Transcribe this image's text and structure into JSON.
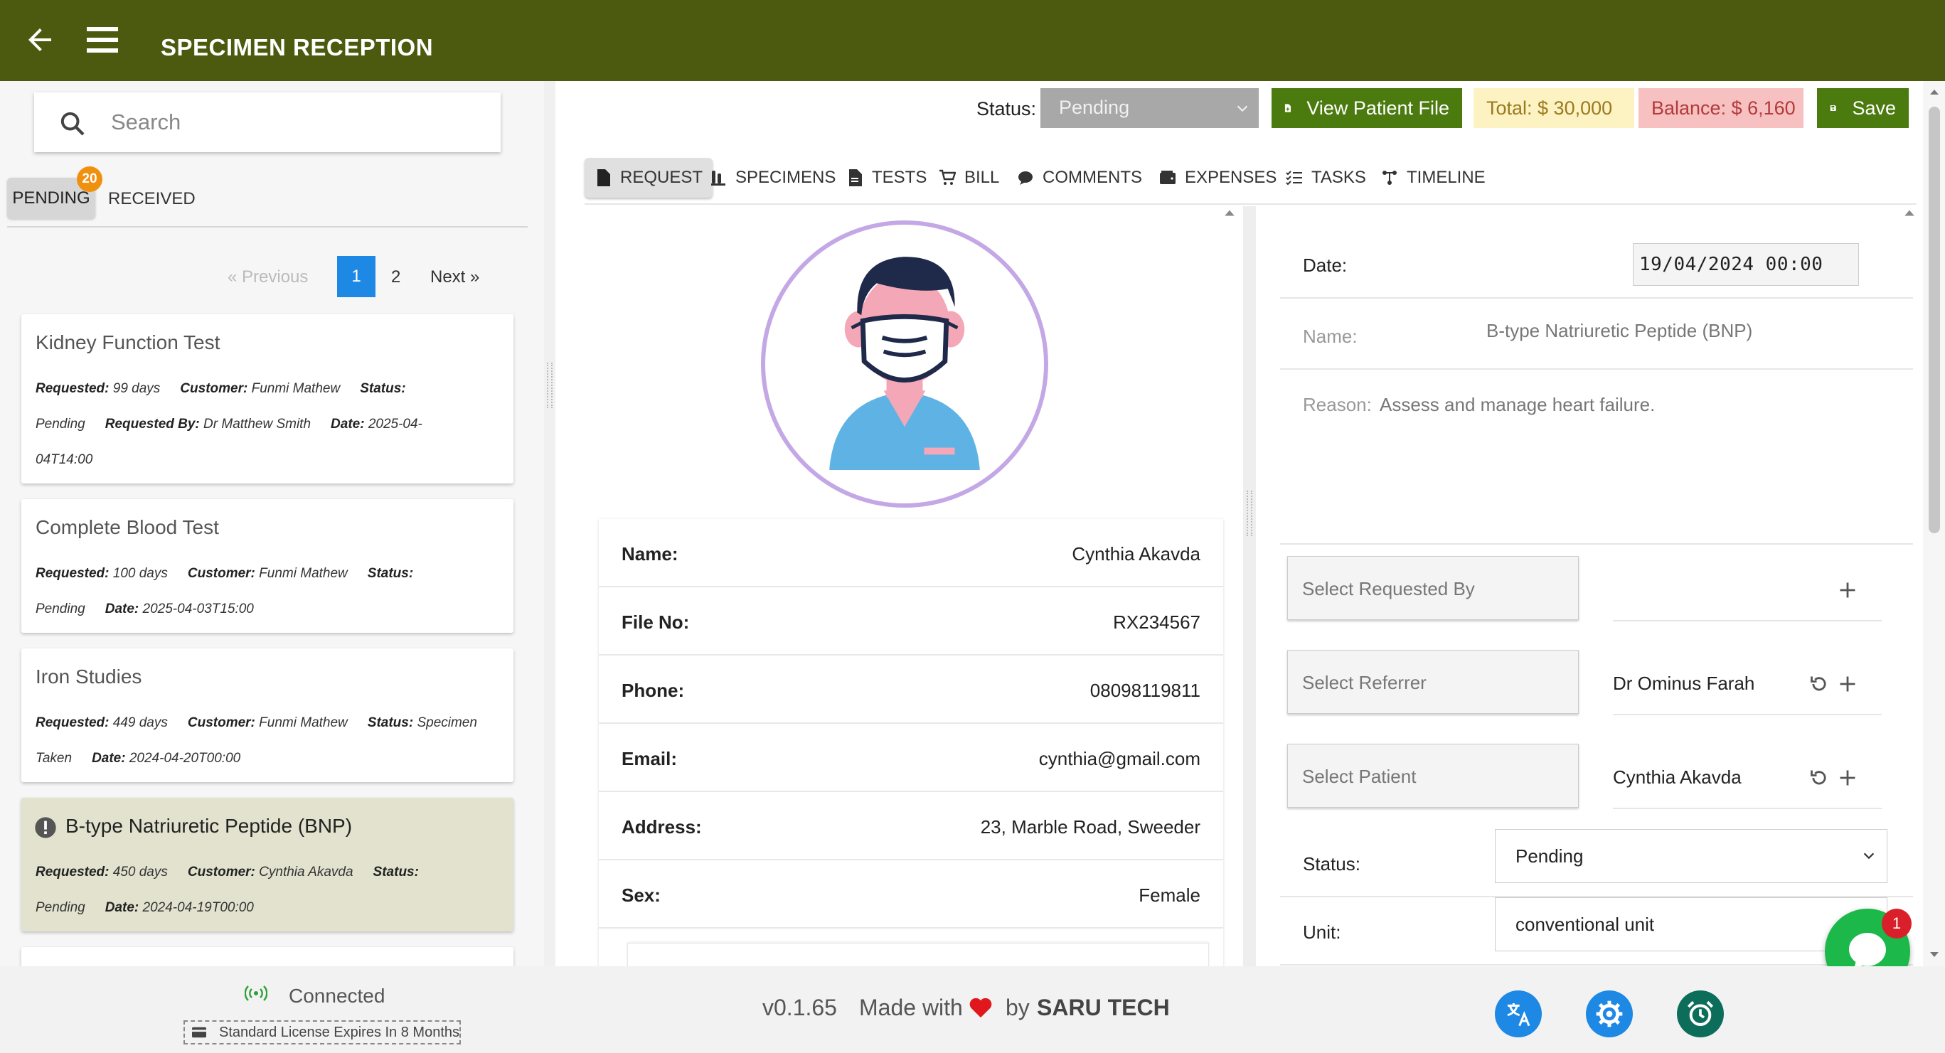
{
  "header": {
    "title": "SPECIMEN RECEPTION"
  },
  "search": {
    "placeholder": "Search"
  },
  "list_tabs": {
    "pending": "PENDING",
    "pending_count": "20",
    "received": "RECEIVED"
  },
  "pagination": {
    "previous": "« Previous",
    "page1": "1",
    "page2": "2",
    "next": "Next »"
  },
  "cards": [
    {
      "title": "Kidney Function Test",
      "lines": [
        [
          {
            "k": "Requested:",
            "v": " 99 days"
          },
          {
            "k": "Customer:",
            "v": " Funmi Mathew"
          },
          {
            "k": "Status:",
            "v": ""
          }
        ],
        [
          {
            "k": "",
            "v": "Pending"
          },
          {
            "k": "Requested By:",
            "v": " Dr Matthew Smith"
          },
          {
            "k": "Date:",
            "v": " 2025-04-"
          }
        ],
        [
          {
            "k": "",
            "v": "04T14:00"
          }
        ]
      ]
    },
    {
      "title": "Complete Blood Test",
      "lines": [
        [
          {
            "k": "Requested:",
            "v": " 100 days"
          },
          {
            "k": "Customer:",
            "v": " Funmi Mathew"
          },
          {
            "k": "Status:",
            "v": ""
          }
        ],
        [
          {
            "k": "",
            "v": "Pending"
          },
          {
            "k": "Date:",
            "v": " 2025-04-03T15:00"
          }
        ]
      ]
    },
    {
      "title": "Iron Studies",
      "lines": [
        [
          {
            "k": "Requested:",
            "v": " 449 days"
          },
          {
            "k": "Customer:",
            "v": " Funmi Mathew"
          },
          {
            "k": "Status:",
            "v": " Specimen"
          }
        ],
        [
          {
            "k": "",
            "v": "Taken"
          },
          {
            "k": "Date:",
            "v": " 2024-04-20T00:00"
          }
        ]
      ]
    },
    {
      "title": "B-type Natriuretic Peptide (BNP)",
      "lines": [
        [
          {
            "k": "Requested:",
            "v": " 450 days"
          },
          {
            "k": "Customer:",
            "v": " Cynthia Akavda"
          },
          {
            "k": "Status:",
            "v": ""
          }
        ],
        [
          {
            "k": "",
            "v": "Pending"
          },
          {
            "k": "Date:",
            "v": " 2024-04-19T00:00"
          }
        ]
      ]
    }
  ],
  "toolbar": {
    "status_label": "Status:",
    "status_value": "Pending",
    "view_patient": "View Patient File",
    "total": "Total: $ 30,000",
    "balance": "Balance: $ 6,160",
    "save": "Save"
  },
  "section_tabs": [
    "REQUEST",
    "SPECIMENS",
    "TESTS",
    "BILL",
    "COMMENTS",
    "EXPENSES",
    "TASKS",
    "TIMELINE"
  ],
  "patient": [
    {
      "label": "Name:",
      "value": "Cynthia Akavda"
    },
    {
      "label": "File No:",
      "value": "RX234567"
    },
    {
      "label": "Phone:",
      "value": "08098119811"
    },
    {
      "label": "Email:",
      "value": "cynthia@gmail.com"
    },
    {
      "label": "Address:",
      "value": "23, Marble Road, Sweeder"
    },
    {
      "label": "Sex:",
      "value": "Female"
    }
  ],
  "request": {
    "date_label": "Date:",
    "date_value": "19/04/2024 00:00",
    "name_label": "Name:",
    "name_value": "B-type Natriuretic Peptide (BNP)",
    "reason_label": "Reason:",
    "reason_value": "Assess and manage heart failure.",
    "requested_by_placeholder": "Select  Requested By",
    "referrer_placeholder": "Select  Referrer",
    "referrer_value": "Dr Ominus Farah",
    "patient_placeholder": "Select  Patient",
    "patient_value": "Cynthia Akavda",
    "status_label": "Status:",
    "status_value": "Pending",
    "unit_label": "Unit:",
    "unit_value": "conventional unit"
  },
  "chat": {
    "badge": "1"
  },
  "footer": {
    "connected": "Connected",
    "license": "Standard License Expires In 8 Months",
    "version": "v0.1.65",
    "made_with": "Made with",
    "by": "by",
    "brand": "SARU TECH"
  },
  "colors": {
    "header_bg": "#4b5a0e",
    "primary_button": "#4b7a0f",
    "total_bg": "#fdf2c2",
    "balance_bg": "#f7c1c1",
    "active_page": "#1e88e5",
    "chat_fab": "#1cb84a",
    "alarm_fab": "#0c6d5b"
  }
}
